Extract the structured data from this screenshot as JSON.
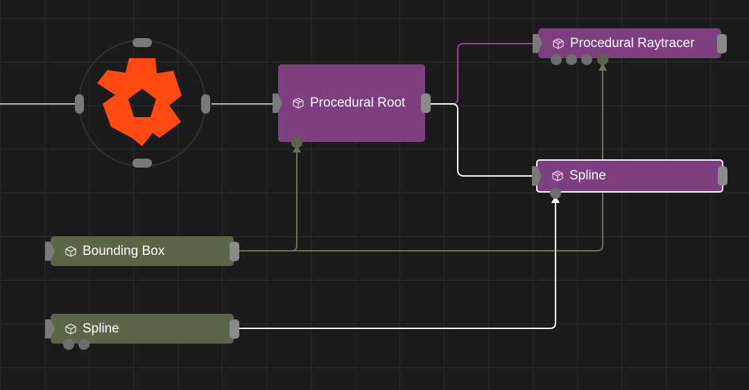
{
  "canvas": {
    "colors": {
      "background": "#1b1b1c",
      "grid": "#2c2c2e",
      "node_purple": "#7e3f80",
      "node_green": "#5b6648",
      "logo": "#ff4a12",
      "wire_white": "#ffffff",
      "wire_gray": "#b9b9b9",
      "wire_purple": "#8f4a8f",
      "wire_green": "#6a7556"
    }
  },
  "logo": {
    "icon": "flower-star-logo-icon"
  },
  "nodes": {
    "procedural_root": {
      "title": "Procedural Root",
      "icon": "package-icon",
      "selected": false
    },
    "procedural_raytracer": {
      "title": "Procedural Raytracer",
      "icon": "package-icon",
      "selected": false
    },
    "spline_purple": {
      "title": "Spline",
      "icon": "package-icon",
      "selected": true
    },
    "bounding_box": {
      "title": "Bounding Box",
      "icon": "cube-icon",
      "selected": false
    },
    "spline_green": {
      "title": "Spline",
      "icon": "cube-icon",
      "selected": false
    }
  }
}
